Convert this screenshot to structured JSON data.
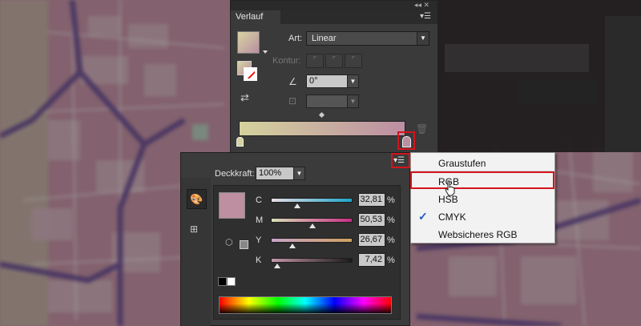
{
  "colors": {
    "highlight": "#d4141c",
    "panel_bg": "#3a3a3a",
    "menu_bg": "#f2f2f2",
    "gradient_start": "#d5d29e",
    "gradient_end": "#bc8ea2",
    "current_color": "#bd8fa0"
  },
  "verlauf_panel": {
    "title": "Verlauf",
    "top_controls": "◂◂ ✕",
    "menu_icon": "panel-menu-icon",
    "art_label": "Art:",
    "art_value": "Linear",
    "kontur_label": "Kontur:",
    "angle_value": "0°",
    "aspect_value": ""
  },
  "farbe_panel": {
    "menu_icon": "panel-menu-icon",
    "deckkraft_label": "Deckkraft:",
    "deckkraft_value": "100%",
    "channels": [
      {
        "label": "C",
        "value": "32,81",
        "unit": "%",
        "fraction": 0.3281
      },
      {
        "label": "M",
        "value": "50,53",
        "unit": "%",
        "fraction": 0.5053
      },
      {
        "label": "Y",
        "value": "26,67",
        "unit": "%",
        "fraction": 0.2667
      },
      {
        "label": "K",
        "value": "7,42",
        "unit": "%",
        "fraction": 0.0742
      }
    ]
  },
  "color_mode_menu": {
    "items": [
      "Graustufen",
      "RGB",
      "HSB",
      "CMYK",
      "Websicheres RGB"
    ],
    "checked": "CMYK",
    "highlighted": "RGB",
    "check_mark": "✓"
  }
}
